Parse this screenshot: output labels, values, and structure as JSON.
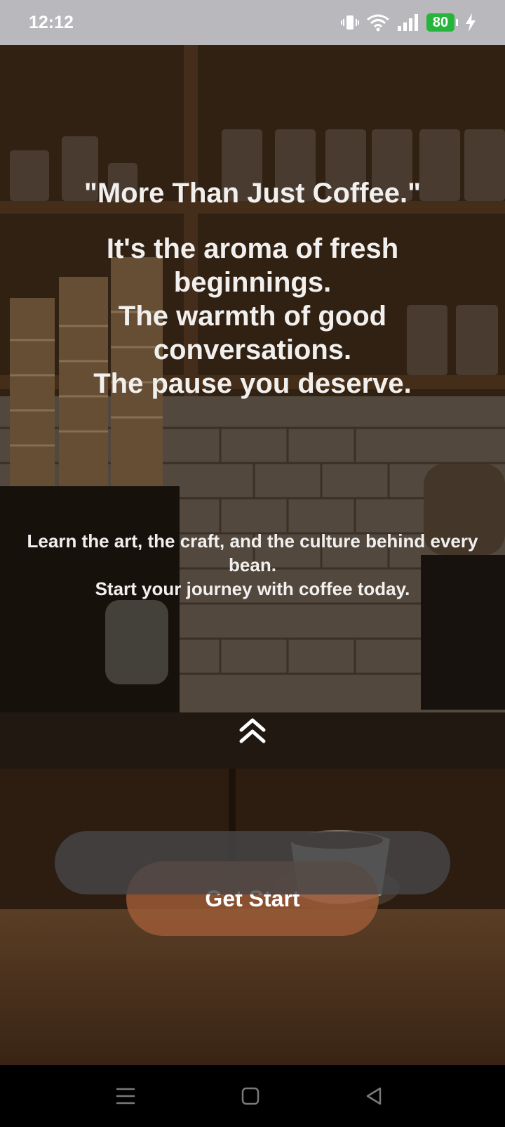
{
  "status_bar": {
    "time": "12:12",
    "battery_level": "80",
    "icons": [
      "vibrate-icon",
      "wifi-icon",
      "signal-icon",
      "battery-icon",
      "charging-icon"
    ]
  },
  "hero": {
    "headline": "\"More Than Just Coffee.\"",
    "subhead_lines": [
      "It's the aroma of fresh beginnings.",
      "The warmth of good conversations.",
      "The pause you deserve."
    ],
    "body_lines": [
      "Learn the art, the craft, and the culture behind every bean.",
      "Start your journey with coffee today."
    ]
  },
  "swipe_icon": "double-chevron-up-icon",
  "cta": {
    "label": "Get Start"
  },
  "nav_bar": {
    "items": [
      "menu-icon",
      "home-icon",
      "back-icon"
    ]
  },
  "colors": {
    "button": "#9b5a37",
    "battery": "#27b43c",
    "status_bar": "#b9b9bd"
  }
}
